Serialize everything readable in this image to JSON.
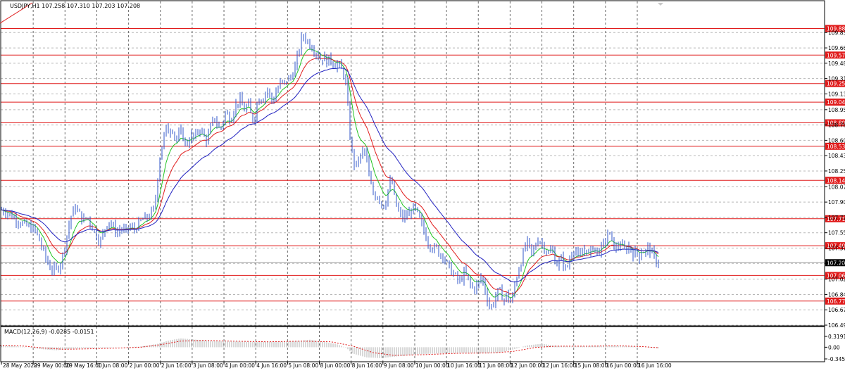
{
  "header": {
    "symbol_info": "USDJPY,H1  107.258 107.310 107.203 107.208"
  },
  "macd_header": "MACD(12,26,9) -0.0285 -0.0151",
  "colors": {
    "candle": "#2f55c8",
    "ma_fast": "#22c322",
    "ma_mid": "#e01b1b",
    "ma_slow": "#2020c0",
    "level_line": "#e01b1b",
    "level_box": "#e01b1b",
    "current_box": "#000000",
    "grid": "#b8b8b8",
    "macd_hist": "#b0b0b0",
    "macd_signal": "#e01b1b"
  },
  "chart_data": {
    "type": "candlestick",
    "ylim": [
      106.495,
      109.99
    ],
    "price_ticks": [
      "109.835",
      "109.660",
      "109.485",
      "109.310",
      "109.135",
      "108.955",
      "108.780",
      "108.605",
      "108.430",
      "108.255",
      "108.075",
      "107.900",
      "107.725",
      "107.550",
      "107.375",
      "107.200",
      "107.020",
      "106.845",
      "106.670",
      "106.495"
    ],
    "levels": [
      {
        "label": "109.882",
        "price": 109.882
      },
      {
        "label": "109.578",
        "price": 109.578
      },
      {
        "label": "109.253",
        "price": 109.253
      },
      {
        "label": "109.041",
        "price": 109.041
      },
      {
        "label": "108.805",
        "price": 108.805
      },
      {
        "label": "108.537",
        "price": 108.537
      },
      {
        "label": "108.148",
        "price": 108.148
      },
      {
        "label": "107.710",
        "price": 107.71
      },
      {
        "label": "107.402",
        "price": 107.402
      },
      {
        "label": "107.062",
        "price": 107.062
      },
      {
        "label": "106.770",
        "price": 106.77
      }
    ],
    "current_price": {
      "label": "107.208",
      "price": 107.208
    },
    "time_labels": [
      "28 May 2020",
      "29 May 00:00",
      "29 May 16:00",
      "1 Jun 08:00",
      "2 Jun 00:00",
      "2 Jun 16:00",
      "3 Jun 08:00",
      "4 Jun 00:00",
      "4 Jun 16:00",
      "5 Jun 08:00",
      "8 Jun 00:00",
      "8 Jun 16:00",
      "9 Jun 08:00",
      "10 Jun 00:00",
      "10 Jun 16:00",
      "11 Jun 08:00",
      "12 Jun 00:00",
      "12 Jun 16:00",
      "15 Jun 08:00",
      "16 Jun 00:00",
      "16 Jun 16:00"
    ],
    "price_path": [
      [
        0,
        107.82
      ],
      [
        10,
        107.78
      ],
      [
        20,
        107.72
      ],
      [
        30,
        107.66
      ],
      [
        40,
        107.62
      ],
      [
        50,
        107.58
      ],
      [
        58,
        107.42
      ],
      [
        64,
        107.28
      ],
      [
        70,
        107.16
      ],
      [
        76,
        107.12
      ],
      [
        82,
        107.14
      ],
      [
        88,
        107.25
      ],
      [
        94,
        107.48
      ],
      [
        100,
        107.72
      ],
      [
        106,
        107.84
      ],
      [
        112,
        107.78
      ],
      [
        118,
        107.68
      ],
      [
        124,
        107.74
      ],
      [
        130,
        107.62
      ],
      [
        136,
        107.54
      ],
      [
        142,
        107.44
      ],
      [
        148,
        107.58
      ],
      [
        154,
        107.7
      ],
      [
        160,
        107.62
      ],
      [
        166,
        107.55
      ],
      [
        172,
        107.6
      ],
      [
        178,
        107.56
      ],
      [
        184,
        107.62
      ],
      [
        190,
        107.58
      ],
      [
        196,
        107.64
      ],
      [
        202,
        107.7
      ],
      [
        208,
        107.72
      ],
      [
        214,
        107.76
      ],
      [
        220,
        107.85
      ],
      [
        224,
        108.2
      ],
      [
        228,
        108.48
      ],
      [
        232,
        108.62
      ],
      [
        236,
        108.74
      ],
      [
        240,
        108.7
      ],
      [
        244,
        108.76
      ],
      [
        248,
        108.66
      ],
      [
        252,
        108.6
      ],
      [
        256,
        108.72
      ],
      [
        260,
        108.64
      ],
      [
        264,
        108.55
      ],
      [
        268,
        108.6
      ],
      [
        272,
        108.66
      ],
      [
        276,
        108.62
      ],
      [
        280,
        108.7
      ],
      [
        284,
        108.74
      ],
      [
        288,
        108.68
      ],
      [
        292,
        108.6
      ],
      [
        296,
        108.66
      ],
      [
        300,
        108.78
      ],
      [
        304,
        108.86
      ],
      [
        308,
        108.8
      ],
      [
        312,
        108.72
      ],
      [
        316,
        108.8
      ],
      [
        320,
        108.92
      ],
      [
        324,
        108.88
      ],
      [
        328,
        108.84
      ],
      [
        332,
        108.96
      ],
      [
        336,
        109.02
      ],
      [
        340,
        109.08
      ],
      [
        344,
        109.0
      ],
      [
        348,
        108.94
      ],
      [
        352,
        109.04
      ],
      [
        356,
        108.9
      ],
      [
        360,
        108.82
      ],
      [
        364,
        108.98
      ],
      [
        368,
        109.1
      ],
      [
        372,
        109.06
      ],
      [
        376,
        109.14
      ],
      [
        380,
        109.18
      ],
      [
        384,
        109.1
      ],
      [
        388,
        109.04
      ],
      [
        392,
        109.16
      ],
      [
        396,
        109.22
      ],
      [
        400,
        109.28
      ],
      [
        404,
        109.24
      ],
      [
        408,
        109.32
      ],
      [
        412,
        109.3
      ],
      [
        416,
        109.38
      ],
      [
        420,
        109.46
      ],
      [
        424,
        109.62
      ],
      [
        428,
        109.76
      ],
      [
        432,
        109.8
      ],
      [
        436,
        109.74
      ],
      [
        440,
        109.7
      ],
      [
        444,
        109.66
      ],
      [
        448,
        109.62
      ],
      [
        452,
        109.58
      ],
      [
        456,
        109.52
      ],
      [
        460,
        109.56
      ],
      [
        464,
        109.5
      ],
      [
        468,
        109.54
      ],
      [
        472,
        109.5
      ],
      [
        476,
        109.46
      ],
      [
        480,
        109.48
      ],
      [
        484,
        109.42
      ],
      [
        488,
        109.36
      ],
      [
        492,
        109.22
      ],
      [
        496,
        108.72
      ],
      [
        500,
        108.46
      ],
      [
        504,
        108.3
      ],
      [
        508,
        108.36
      ],
      [
        512,
        108.42
      ],
      [
        516,
        108.5
      ],
      [
        520,
        108.44
      ],
      [
        524,
        108.18
      ],
      [
        528,
        108.05
      ],
      [
        532,
        107.96
      ],
      [
        536,
        107.98
      ],
      [
        540,
        107.92
      ],
      [
        544,
        107.84
      ],
      [
        548,
        107.92
      ],
      [
        552,
        108.08
      ],
      [
        556,
        108.16
      ],
      [
        560,
        107.96
      ],
      [
        564,
        107.82
      ],
      [
        568,
        107.76
      ],
      [
        572,
        107.72
      ],
      [
        576,
        107.74
      ],
      [
        580,
        107.76
      ],
      [
        584,
        107.8
      ],
      [
        588,
        107.84
      ],
      [
        592,
        107.78
      ],
      [
        596,
        107.7
      ],
      [
        600,
        107.62
      ],
      [
        604,
        107.52
      ],
      [
        608,
        107.44
      ],
      [
        612,
        107.4
      ],
      [
        616,
        107.36
      ],
      [
        620,
        107.38
      ],
      [
        624,
        107.3
      ],
      [
        628,
        107.32
      ],
      [
        632,
        107.24
      ],
      [
        636,
        107.18
      ],
      [
        640,
        107.12
      ],
      [
        644,
        107.08
      ],
      [
        648,
        107.04
      ],
      [
        652,
        106.98
      ],
      [
        656,
        107.04
      ],
      [
        660,
        107.1
      ],
      [
        664,
        107.02
      ],
      [
        668,
        106.96
      ],
      [
        672,
        106.9
      ],
      [
        676,
        106.94
      ],
      [
        680,
        106.98
      ],
      [
        684,
        107.06
      ],
      [
        688,
        106.92
      ],
      [
        692,
        106.8
      ],
      [
        696,
        106.68
      ],
      [
        700,
        106.74
      ],
      [
        704,
        106.82
      ],
      [
        708,
        106.9
      ],
      [
        712,
        106.84
      ],
      [
        716,
        106.78
      ],
      [
        720,
        106.86
      ],
      [
        724,
        106.74
      ],
      [
        728,
        106.82
      ],
      [
        732,
        107.0
      ],
      [
        736,
        107.12
      ],
      [
        740,
        107.22
      ],
      [
        744,
        107.34
      ],
      [
        748,
        107.46
      ],
      [
        752,
        107.38
      ],
      [
        756,
        107.3
      ],
      [
        760,
        107.4
      ],
      [
        764,
        107.48
      ],
      [
        768,
        107.44
      ],
      [
        772,
        107.4
      ],
      [
        776,
        107.34
      ],
      [
        780,
        107.3
      ],
      [
        784,
        107.38
      ],
      [
        788,
        107.24
      ],
      [
        792,
        107.18
      ],
      [
        796,
        107.26
      ],
      [
        800,
        107.2
      ],
      [
        804,
        107.12
      ],
      [
        808,
        107.22
      ],
      [
        812,
        107.32
      ],
      [
        816,
        107.38
      ],
      [
        820,
        107.3
      ],
      [
        824,
        107.26
      ],
      [
        828,
        107.34
      ],
      [
        832,
        107.38
      ],
      [
        836,
        107.3
      ],
      [
        840,
        107.36
      ],
      [
        844,
        107.4
      ],
      [
        848,
        107.32
      ],
      [
        852,
        107.36
      ],
      [
        856,
        107.4
      ],
      [
        860,
        107.46
      ],
      [
        864,
        107.56
      ],
      [
        868,
        107.48
      ],
      [
        872,
        107.4
      ],
      [
        876,
        107.36
      ],
      [
        880,
        107.44
      ],
      [
        884,
        107.38
      ],
      [
        888,
        107.34
      ],
      [
        892,
        107.4
      ],
      [
        896,
        107.36
      ],
      [
        900,
        107.3
      ],
      [
        904,
        107.34
      ],
      [
        908,
        107.28
      ],
      [
        912,
        107.36
      ],
      [
        916,
        107.32
      ],
      [
        920,
        107.38
      ],
      [
        924,
        107.34
      ],
      [
        928,
        107.28
      ],
      [
        932,
        107.22
      ],
      [
        936,
        107.21
      ]
    ],
    "macd": {
      "ylim": [
        -0.3455,
        0.3191
      ],
      "ticks": [
        "0.3191",
        "0.00",
        "-0.3455"
      ],
      "hist": [
        [
          0,
          0.05
        ],
        [
          30,
          0.02
        ],
        [
          60,
          -0.06
        ],
        [
          80,
          -0.09
        ],
        [
          100,
          -0.05
        ],
        [
          130,
          -0.02
        ],
        [
          160,
          -0.01
        ],
        [
          200,
          0.02
        ],
        [
          224,
          0.1
        ],
        [
          240,
          0.2
        ],
        [
          256,
          0.26
        ],
        [
          280,
          0.22
        ],
        [
          300,
          0.18
        ],
        [
          330,
          0.17
        ],
        [
          360,
          0.16
        ],
        [
          390,
          0.16
        ],
        [
          420,
          0.18
        ],
        [
          440,
          0.22
        ],
        [
          460,
          0.16
        ],
        [
          480,
          0.08
        ],
        [
          492,
          -0.02
        ],
        [
          500,
          -0.18
        ],
        [
          520,
          -0.3
        ],
        [
          540,
          -0.32
        ],
        [
          560,
          -0.28
        ],
        [
          580,
          -0.24
        ],
        [
          600,
          -0.2
        ],
        [
          630,
          -0.18
        ],
        [
          660,
          -0.16
        ],
        [
          690,
          -0.18
        ],
        [
          710,
          -0.16
        ],
        [
          730,
          -0.06
        ],
        [
          750,
          0.06
        ],
        [
          770,
          0.1
        ],
        [
          790,
          0.04
        ],
        [
          810,
          0.02
        ],
        [
          840,
          0.04
        ],
        [
          870,
          0.05
        ],
        [
          900,
          0.02
        ],
        [
          936,
          -0.03
        ]
      ],
      "signal": [
        [
          0,
          0.06
        ],
        [
          30,
          0.04
        ],
        [
          60,
          -0.02
        ],
        [
          90,
          -0.06
        ],
        [
          120,
          -0.05
        ],
        [
          160,
          -0.03
        ],
        [
          200,
          0.0
        ],
        [
          230,
          0.08
        ],
        [
          256,
          0.18
        ],
        [
          290,
          0.2
        ],
        [
          330,
          0.18
        ],
        [
          380,
          0.16
        ],
        [
          430,
          0.18
        ],
        [
          470,
          0.16
        ],
        [
          500,
          0.04
        ],
        [
          530,
          -0.16
        ],
        [
          560,
          -0.24
        ],
        [
          600,
          -0.22
        ],
        [
          650,
          -0.18
        ],
        [
          700,
          -0.17
        ],
        [
          730,
          -0.12
        ],
        [
          760,
          -0.01
        ],
        [
          790,
          0.03
        ],
        [
          830,
          0.03
        ],
        [
          880,
          0.04
        ],
        [
          910,
          0.02
        ],
        [
          936,
          -0.015
        ]
      ]
    }
  }
}
